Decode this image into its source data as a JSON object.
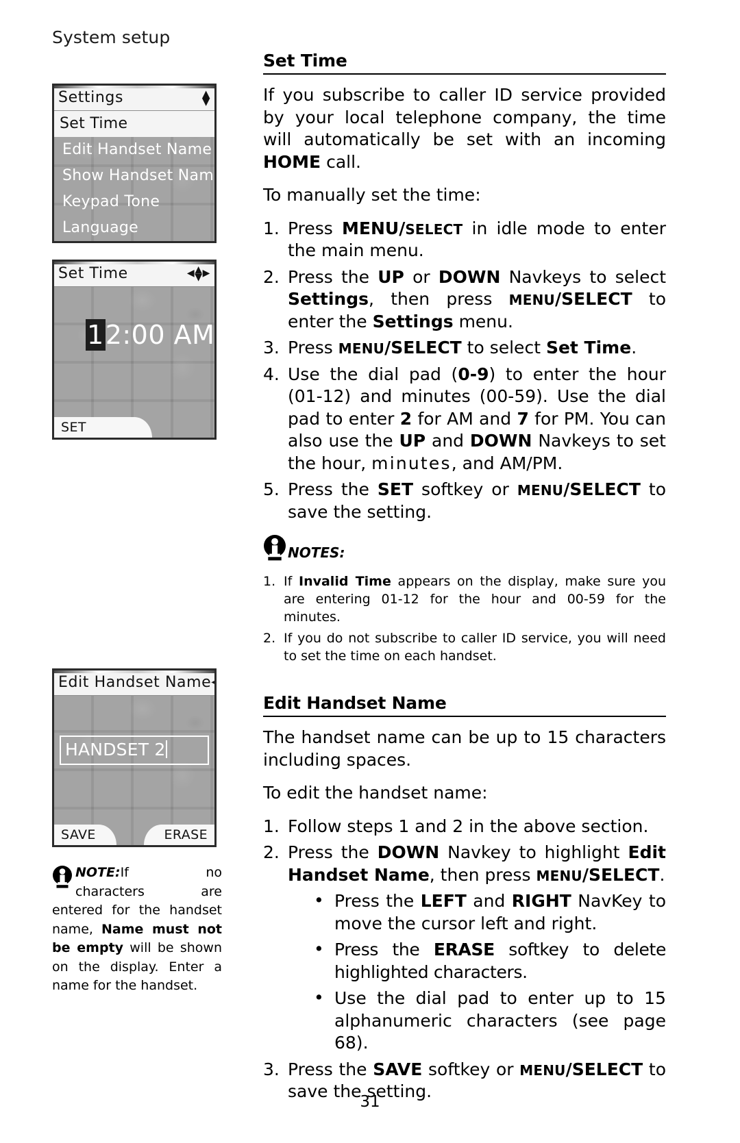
{
  "running_head": "System setup",
  "page_number": "31",
  "screens": {
    "settings_menu": {
      "title": "Settings",
      "nav_indicator": "up-down-arrows",
      "items": [
        {
          "label": "Set Time",
          "state": "selected"
        },
        {
          "label": "Edit Handset Name",
          "state": "normal"
        },
        {
          "label": "Show Handset Name",
          "state": "normal"
        },
        {
          "label": "Keypad Tone",
          "state": "normal"
        },
        {
          "label": "Language",
          "state": "normal"
        }
      ]
    },
    "set_time": {
      "title": "Set Time",
      "nav_indicator": "four-way-arrows",
      "time_highlighted": "1",
      "time_rest": "2:00 AM",
      "softkey_left": "SET"
    },
    "edit_handset_name": {
      "title": "Edit Handset Name",
      "nav_indicator": "left-right-arrows",
      "field_value": "HANDSET 2",
      "softkey_left": "SAVE",
      "softkey_right": "ERASE"
    }
  },
  "set_time_section": {
    "heading": "Set Time",
    "intro_a": "If you subscribe to caller ID service provided by your local telephone company, the time will automatically be set with an incoming ",
    "intro_bold": "HOME",
    "intro_b": " call.",
    "lead_in": "To manually set the time:",
    "steps": [
      {
        "parts": [
          {
            "t": "Press  ",
            "s": "n"
          },
          {
            "t": "MENU/",
            "s": "b"
          },
          {
            "t": "SELECT",
            "s": "sc"
          },
          {
            "t": " in idle mode to enter the main menu.",
            "s": "n"
          }
        ]
      },
      {
        "parts": [
          {
            "t": "Press  the  ",
            "s": "n"
          },
          {
            "t": "UP",
            "s": "b"
          },
          {
            "t": "  or  ",
            "s": "n"
          },
          {
            "t": "DOWN",
            "s": "b"
          },
          {
            "t": "  Navkeys  to  select  ",
            "s": "n"
          },
          {
            "t": "Settings",
            "s": "b"
          },
          {
            "t": ", then press ",
            "s": "n"
          },
          {
            "t": "MENU",
            "s": "sc"
          },
          {
            "t": "/SELECT",
            "s": "b"
          },
          {
            "t": " to enter the ",
            "s": "n"
          },
          {
            "t": "Settings",
            "s": "b"
          },
          {
            "t": " menu.",
            "s": "n"
          }
        ]
      },
      {
        "parts": [
          {
            "t": "Press ",
            "s": "n"
          },
          {
            "t": "MENU",
            "s": "sc"
          },
          {
            "t": "/SELECT",
            "s": "b"
          },
          {
            "t": " to select ",
            "s": "n"
          },
          {
            "t": "Set Time",
            "s": "b"
          },
          {
            "t": ".",
            "s": "n"
          }
        ]
      },
      {
        "parts": [
          {
            "t": "Use the dial pad (",
            "s": "n"
          },
          {
            "t": "0-9",
            "s": "b"
          },
          {
            "t": ") to enter the hour (01-12) and minutes (00-59). Use the dial pad to enter ",
            "s": "n"
          },
          {
            "t": "2",
            "s": "b"
          },
          {
            "t": " for AM and ",
            "s": "n"
          },
          {
            "t": "7",
            "s": "b"
          },
          {
            "t": " for PM. You can also use the  ",
            "s": "n"
          },
          {
            "t": "UP",
            "s": "b"
          },
          {
            "t": " and ",
            "s": "n"
          },
          {
            "t": "DOWN",
            "s": "b"
          },
          {
            "t": " Navkeys to set the hour, ",
            "s": "n"
          },
          {
            "t": "minutes",
            "s": "sp"
          },
          {
            "t": ", and AM/PM.",
            "s": "n"
          }
        ]
      },
      {
        "parts": [
          {
            "t": "Press the ",
            "s": "n"
          },
          {
            "t": "SET",
            "s": "b"
          },
          {
            "t": " softkey or ",
            "s": "n"
          },
          {
            "t": "MENU",
            "s": "sc"
          },
          {
            "t": "/SELECT",
            "s": "b"
          },
          {
            "t": " to save the setting.",
            "s": "n"
          }
        ]
      }
    ],
    "notes_label": "NOTES:",
    "notes": [
      {
        "parts": [
          {
            "t": "If ",
            "s": "n"
          },
          {
            "t": "Invalid Time",
            "s": "b"
          },
          {
            "t": " appears on the display, make sure you are entering 01-12 for the hour and 00-59 for the minutes.",
            "s": "n"
          }
        ]
      },
      {
        "parts": [
          {
            "t": "If you do not subscribe to caller ID service, you will need to set the time on each handset.",
            "s": "n"
          }
        ]
      }
    ]
  },
  "edit_handset_section": {
    "heading": "Edit Handset Name",
    "intro": "The handset name can be up to 15 characters including spaces.",
    "lead_in": "To edit the handset name:",
    "steps": [
      {
        "parts": [
          {
            "t": "Follow steps 1 and 2 in the above section.",
            "s": "n"
          }
        ]
      },
      {
        "parts": [
          {
            "t": "Press  the  ",
            "s": "n"
          },
          {
            "t": "DOWN",
            "s": "b"
          },
          {
            "t": "  Navkey  to  highlight  ",
            "s": "n"
          },
          {
            "t": "Edit Handset Name",
            "s": "b"
          },
          {
            "t": ", then press ",
            "s": "n"
          },
          {
            "t": "MENU",
            "s": "sc"
          },
          {
            "t": "/SELECT",
            "s": "b"
          },
          {
            "t": ".",
            "s": "n"
          }
        ],
        "bullets": [
          {
            "parts": [
              {
                "t": "Press the ",
                "s": "n"
              },
              {
                "t": "LEFT",
                "s": "b"
              },
              {
                "t": " and ",
                "s": "n"
              },
              {
                "t": "RIGHT",
                "s": "b"
              },
              {
                "t": " NavKey to move the cursor left and right.",
                "s": "n"
              }
            ]
          },
          {
            "parts": [
              {
                "t": "Press the ",
                "s": "n"
              },
              {
                "t": "ERASE",
                "s": "b"
              },
              {
                "t": " softkey to delete highlighted characters.",
                "s": "n"
              }
            ],
            "tight": true
          },
          {
            "parts": [
              {
                "t": "Use the dial pad to enter up to 15 alphanumeric characters (see page 68).",
                "s": "n"
              }
            ]
          }
        ]
      },
      {
        "parts": [
          {
            "t": "Press the ",
            "s": "n"
          },
          {
            "t": "SAVE",
            "s": "b"
          },
          {
            "t": " softkey or ",
            "s": "n"
          },
          {
            "t": "MENU",
            "s": "sc"
          },
          {
            "t": "/SELECT",
            "s": "b"
          },
          {
            "t": " to save the setting.",
            "s": "n"
          }
        ]
      }
    ]
  },
  "left_note": {
    "label": "NOTE:",
    "parts": [
      {
        "t": "If no characters are entered for the handset name, ",
        "s": "n"
      },
      {
        "t": "Name must not be empty",
        "s": "b"
      },
      {
        "t": " will be shown on the display. Enter a name for the handset.",
        "s": "n"
      }
    ]
  },
  "colors": {
    "page_background": "#ffffff",
    "text": "#000000",
    "lcd_background": "#9a9a9a",
    "lcd_border": "#2b2b2b",
    "lcd_titlebar": "#f4f4f4",
    "lcd_highlight": "#1d1d1d",
    "lcd_text_dim": "#ffffff"
  }
}
